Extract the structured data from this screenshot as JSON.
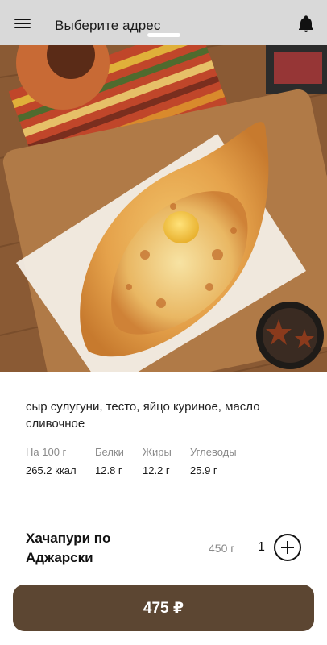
{
  "header": {
    "address_label": "Выберите адрес",
    "menu_icon": "menu-icon",
    "notification_icon": "bell-icon"
  },
  "product": {
    "image": "khachapuri-photo",
    "description": "сыр сулугуни, тесто, яйцо куриное, масло сливочное",
    "nutrition": [
      {
        "label": "На 100 г",
        "value": "265.2 ккал"
      },
      {
        "label": "Белки",
        "value": "12.8 г"
      },
      {
        "label": "Жиры",
        "value": "12.2 г"
      },
      {
        "label": "Углеводы",
        "value": "25.9 г"
      }
    ],
    "name": "Хачапури по Аджарски",
    "weight": "450 г",
    "quantity": "1",
    "price_button": "475 ₽"
  },
  "colors": {
    "header_bg": "#d9d9d9",
    "accent": "#5c4632"
  }
}
